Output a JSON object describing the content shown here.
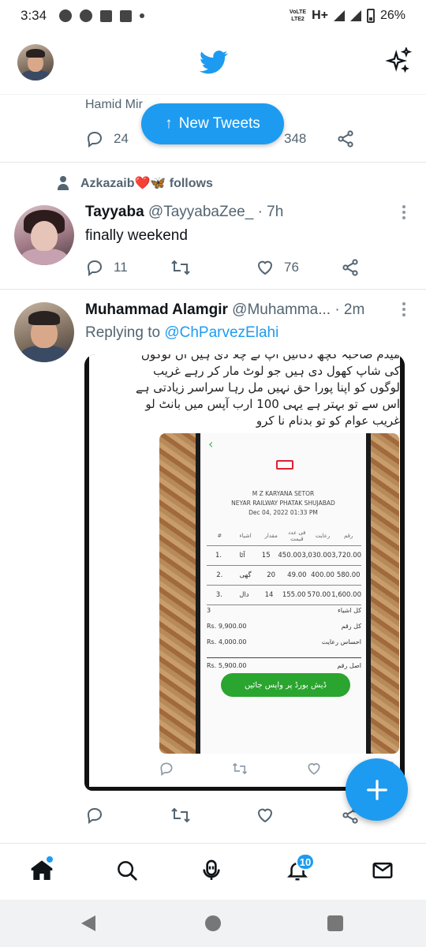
{
  "status_bar": {
    "time": "3:34",
    "network_volte_top": "VoLTE",
    "network_volte_bottom": "LTE2",
    "network_type": "H+",
    "battery": "26%"
  },
  "header": {
    "logo_icon": "twitter-bird-icon",
    "sparkle_icon": "sparkle-icon"
  },
  "new_tweets_pill": {
    "arrow": "↑",
    "label": "New Tweets"
  },
  "prev_tweet": {
    "partial_author": "Hamid Mir",
    "replies": "24",
    "retweets": "",
    "likes": "348"
  },
  "tweet1": {
    "social_context": "Azkazaib❤️🦋 follows",
    "name": "Tayyaba",
    "handle": "@TayyabaZee_",
    "time": "· 7h",
    "text": "finally weekend",
    "replies": "11",
    "retweets": "",
    "likes": "76"
  },
  "tweet2": {
    "name": "Muhammad Alamgir",
    "handle": "@Muhamma...",
    "time": "· 2m",
    "replying_prefix": "Replying to",
    "replying_to": "@ChParvezElahi",
    "embed_text": [
      "میڈم صاحبہ کچھ دکانیں آپ نے چلا دی ہیں ان لوگوں",
      "کی شاپ کھول دی ہیں جو لوٹ مار کر رہے غریب",
      "لوگوں کو اپنا پورا حق نہیں مل رہا سراسر زیادتی ہے",
      "اس سے تو بہتر ہے یہی 100 ارب آپس میں بانٹ لو",
      "غریب عوام کو تو بدنام نا کرو"
    ],
    "receipt": {
      "shop_name": "M Z KARYANA SETOR",
      "address": "NEYAR RAILWAY PHATAK SHUJABAD",
      "date": "Dec 04, 2022 01:33 PM",
      "headers": [
        "#",
        "اشیاء",
        "مقدار",
        "فی عدد قیمت",
        "رعایت",
        "رقم"
      ],
      "rows": [
        [
          "1.",
          "آٹا",
          "15",
          "450.00",
          "3,030.00",
          "3,720.00"
        ],
        [
          "2.",
          "گھی",
          "20",
          "49.00",
          "400.00",
          "580.00"
        ],
        [
          "3.",
          "دال",
          "14",
          "155.00",
          "570.00",
          "1,600.00"
        ]
      ],
      "total_items_value": "3",
      "total_items_label": "کل اشیاء",
      "total_amount_value": "Rs. 9,900.00",
      "total_amount_label": "کل رقم",
      "discount_value": "Rs. 4,000.00",
      "discount_label": "احساس رعایت",
      "net_value": "Rs. 5,900.00",
      "net_label": "اصل رقم",
      "button_label": "ڈیش بورڈ پر واپس جائیں"
    }
  },
  "bottom_nav": {
    "items": [
      "home-icon",
      "search-icon",
      "spaces-icon",
      "notifications-icon",
      "messages-icon"
    ],
    "notification_count": "10"
  },
  "colors": {
    "accent": "#1d9bf0",
    "text": "#0f1419",
    "secondary": "#536471",
    "like_heart": "#e0245e",
    "receipt_green": "#2aa52f"
  }
}
